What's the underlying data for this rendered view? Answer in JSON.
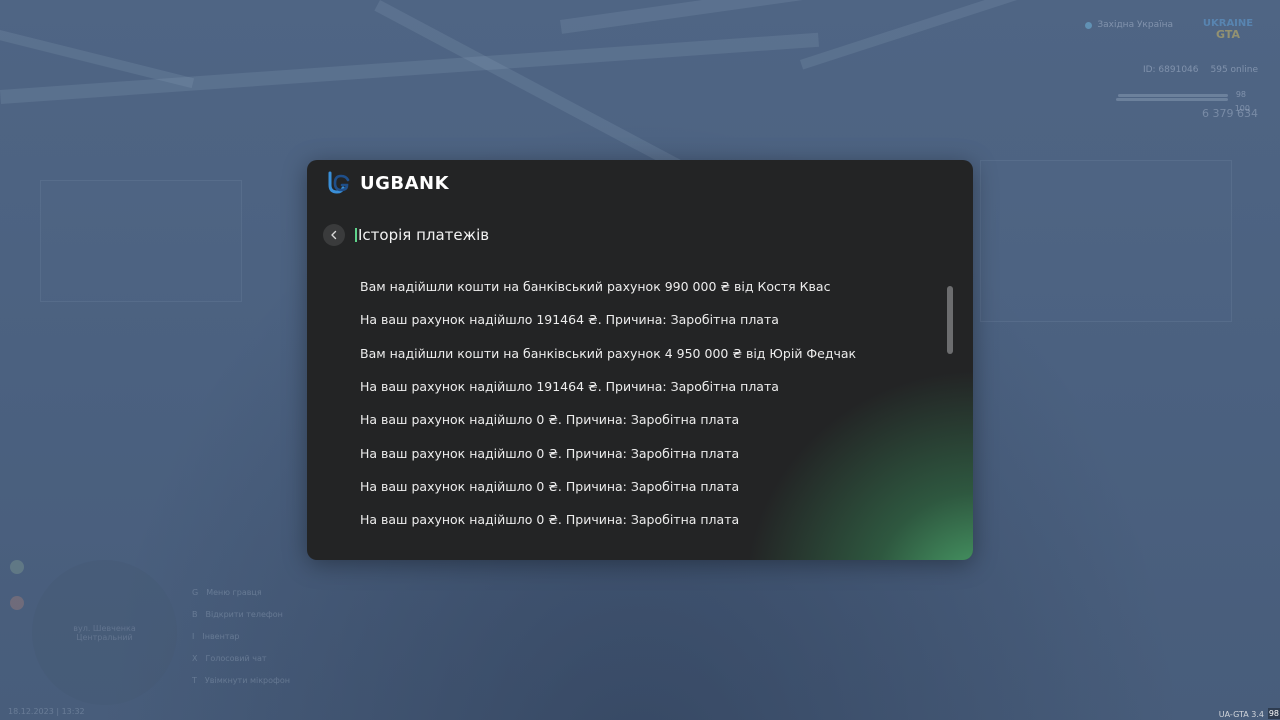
{
  "hud": {
    "server_name": "Західна Україна",
    "logo_top": "UKRAINE",
    "logo_bottom": "GTA",
    "player_id": "ID: 6891046",
    "online": "595 online",
    "bar1_value": "98",
    "bar2_value": "100",
    "money": "6 379 634",
    "minimap_line1": "вул. Шевченка",
    "minimap_line2": "Центральний",
    "menu": [
      {
        "key": "G",
        "label": "Меню гравця"
      },
      {
        "key": "B",
        "label": "Відкрити телефон"
      },
      {
        "key": "I",
        "label": "Інвентар"
      },
      {
        "key": "X",
        "label": "Голосовий чат"
      },
      {
        "key": "T",
        "label": "Увімкнути мікрофон"
      }
    ],
    "date": "18.12.2023 | 13:32",
    "version": "UA-GTA 3.4",
    "fps": "98"
  },
  "bank": {
    "title": "UGBANK",
    "logo_letters": "UG",
    "section_title": "Історія платежів",
    "transactions": [
      "Вам надійшли кошти на банківський рахунок 990 000 ₴ від Костя Квас",
      "На ваш рахунок надійшло 191464 ₴. Причина: Заробітна плата",
      "Вам надійшли кошти на банківський рахунок 4 950 000 ₴ від Юрій Федчак",
      "На ваш рахунок надійшло 191464 ₴. Причина: Заробітна плата",
      "На ваш рахунок надійшло 0 ₴. Причина: Заробітна плата",
      "На ваш рахунок надійшло 0 ₴. Причина: Заробітна плата",
      "На ваш рахунок надійшло 0 ₴. Причина: Заробітна плата",
      "На ваш рахунок надійшло 0 ₴. Причина: Заробітна плата"
    ]
  },
  "colors": {
    "window_bg": "#232425",
    "accent_green": "#5fd38b",
    "logo_blue": "#3a8fd8"
  }
}
